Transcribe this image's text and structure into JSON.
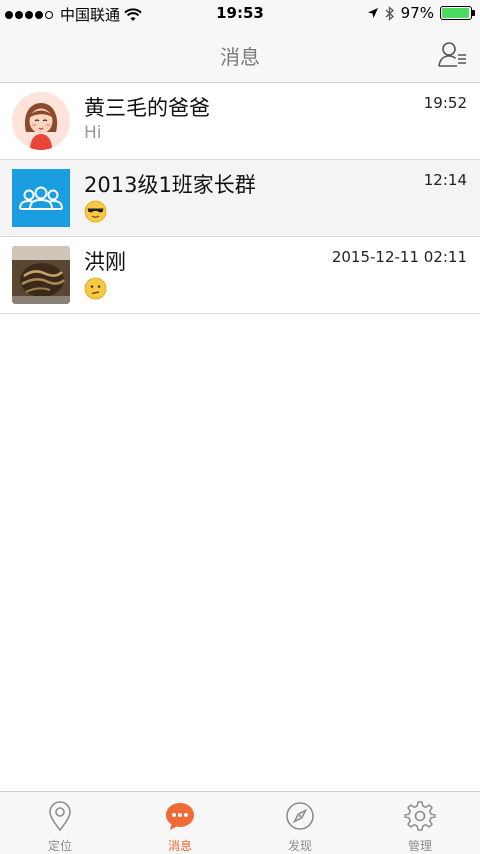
{
  "status_bar": {
    "carrier": "中国联通",
    "time": "19:53",
    "battery": "97%",
    "battery_level": 0.97
  },
  "nav": {
    "title": "消息"
  },
  "conversations": [
    {
      "name": "黄三毛的爸爸",
      "time": "19:52",
      "message": "Hi",
      "avatar": "girl-avatar"
    },
    {
      "name": "2013级1班家长群",
      "time": "12:14",
      "message_icon": "sunglasses-emoji-icon",
      "avatar": "group-avatar"
    },
    {
      "name": "洪刚",
      "time": "2015-12-11 02:11",
      "message_icon": "confused-emoji-icon",
      "avatar": "photo-avatar"
    }
  ],
  "tabs": [
    {
      "label": "定位",
      "icon": "location-pin-icon",
      "active": false
    },
    {
      "label": "消息",
      "icon": "chat-bubble-icon",
      "active": true
    },
    {
      "label": "发现",
      "icon": "compass-icon",
      "active": false
    },
    {
      "label": "管理",
      "icon": "gear-icon",
      "active": false
    }
  ],
  "colors": {
    "accent": "#f06a35",
    "group_avatar": "#1a9ee0",
    "battery": "#4cd964"
  }
}
